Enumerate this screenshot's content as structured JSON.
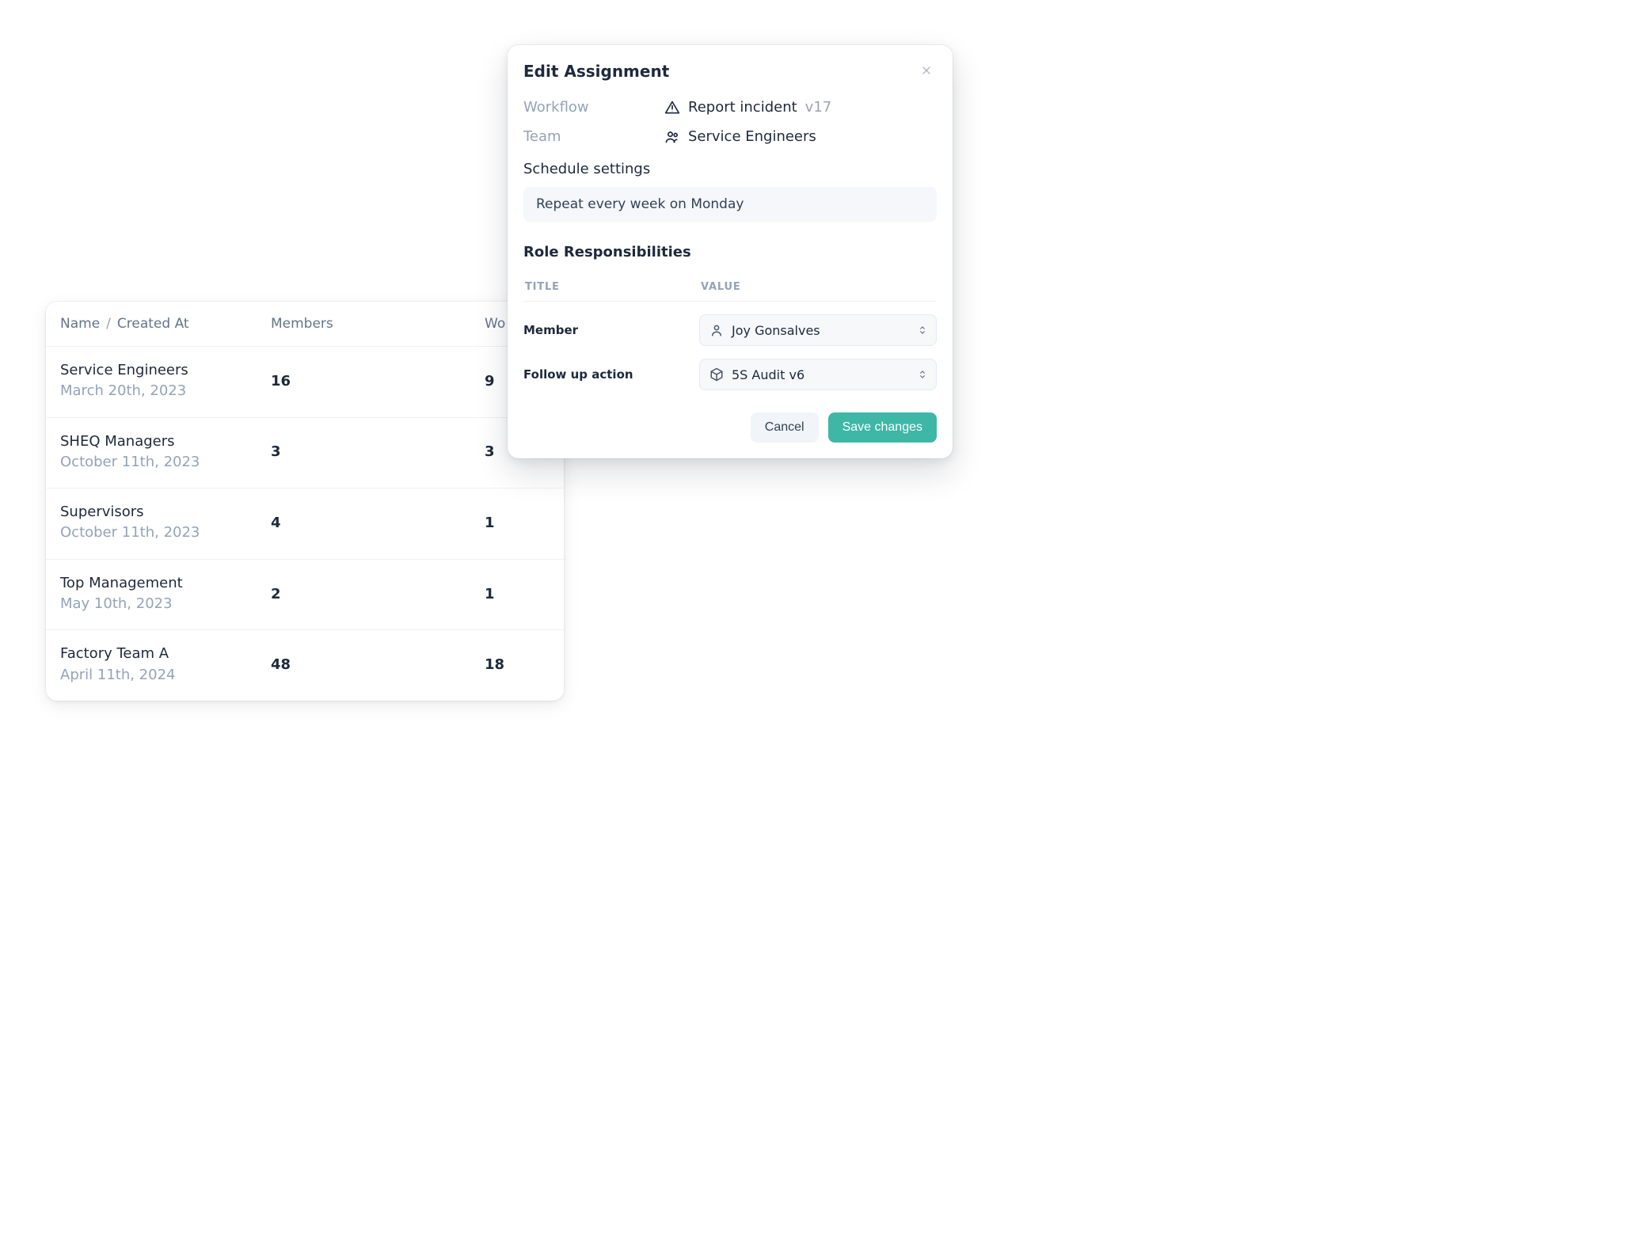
{
  "table": {
    "headers": {
      "name": "Name",
      "created_at": "Created At",
      "members": "Members",
      "workflows_partial": "Wo"
    },
    "rows": [
      {
        "name": "Service Engineers",
        "date": "March 20th, 2023",
        "members": "16",
        "workflows": "9"
      },
      {
        "name": "SHEQ Managers",
        "date": "October 11th, 2023",
        "members": "3",
        "workflows": "3"
      },
      {
        "name": "Supervisors",
        "date": "October 11th, 2023",
        "members": "4",
        "workflows": "1"
      },
      {
        "name": "Top Management",
        "date": "May 10th, 2023",
        "members": "2",
        "workflows": "1"
      },
      {
        "name": "Factory Team A",
        "date": "April 11th, 2024",
        "members": "48",
        "workflows": "18"
      }
    ]
  },
  "modal": {
    "title": "Edit Assignment",
    "labels": {
      "workflow": "Workflow",
      "team": "Team"
    },
    "workflow": {
      "name": "Report incident",
      "version": "v17"
    },
    "team": "Service Engineers",
    "schedule": {
      "title": "Schedule settings",
      "text": "Repeat every week on Monday"
    },
    "roles": {
      "title": "Role Responsibilities",
      "columns": {
        "title": "TITLE",
        "value": "VALUE"
      },
      "rows": [
        {
          "label": "Member",
          "value": "Joy Gonsalves",
          "icon": "user"
        },
        {
          "label": "Follow up action",
          "value": "5S Audit v6",
          "icon": "cube"
        }
      ]
    },
    "buttons": {
      "cancel": "Cancel",
      "save": "Save changes"
    }
  }
}
